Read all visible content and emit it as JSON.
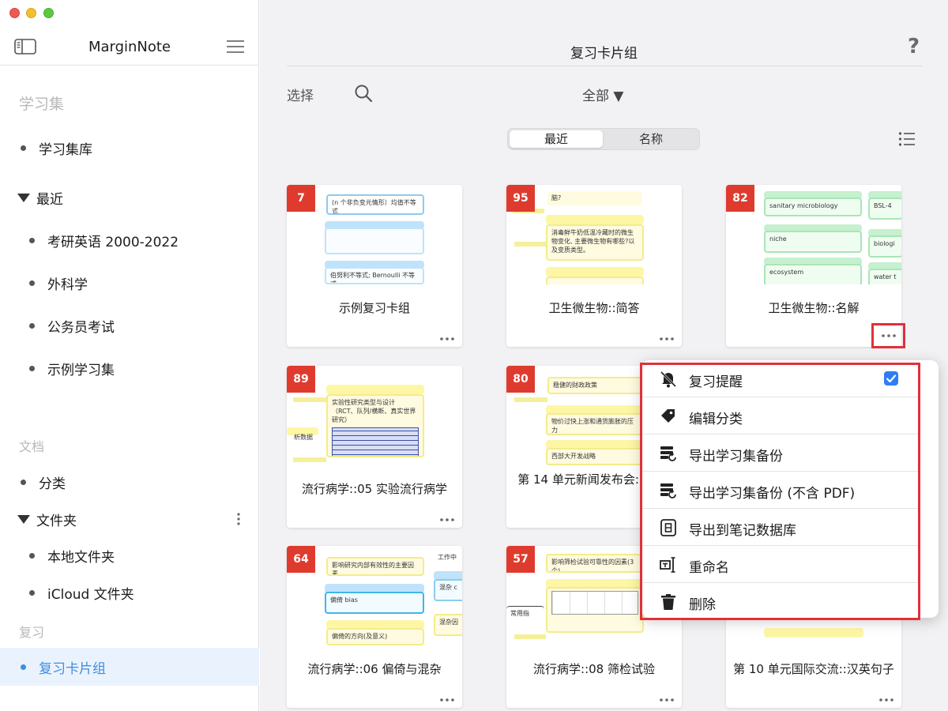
{
  "sidebar": {
    "app_title": "MarginNote",
    "section_study": "学习集",
    "library": "学习集库",
    "recent": "最近",
    "recent_items": [
      "考研英语 2000-2022",
      "外科学",
      "公务员考试",
      "示例学习集"
    ],
    "section_docs": "文档",
    "categories": "分类",
    "folders": "文件夹",
    "folder_items": [
      "本地文件夹",
      "iCloud 文件夹"
    ],
    "section_review": "复习",
    "review_active": "复习卡片组"
  },
  "main": {
    "title": "复习卡片组",
    "help": "?",
    "select": "选择",
    "filter": "全部 ▼",
    "seg_recent": "最近",
    "seg_name": "名称"
  },
  "cards": [
    {
      "count": "7",
      "title": "示例复习卡组",
      "thumb": [
        "(n 个非负变元情形）均值不等式",
        "伯努利不等式; Bernoulli 不等式;"
      ]
    },
    {
      "count": "95",
      "title": "卫生微生物::简答",
      "thumb": [
        "脑?",
        "消毒鲜牛奶低温冷藏时的微生物变化, 主要微生物有哪些?以及变质类型。"
      ]
    },
    {
      "count": "82",
      "title": "卫生微生物::名解",
      "thumb": [
        "sanitary microbiology",
        "BSL-4",
        "niche",
        "biologi",
        "ecosystem",
        "water t"
      ]
    },
    {
      "count": "89",
      "title": "流行病学::05 实验流行病学",
      "thumb": [
        "实验性研究类型与设计（RCT、队列/横断、真实世界研究）",
        "析数据"
      ]
    },
    {
      "count": "80",
      "title": "第 14 单元新闻发布会:: 词语",
      "thumb": [
        "稳健的财政政策",
        "物价过快上涨和通货膨胀的压力",
        "西部大开发战略"
      ]
    },
    {
      "count": "64",
      "title": "流行病学::06 偏倚与混杂",
      "thumb": [
        "影响研究内部有效性的主要因素",
        "工作中",
        "偏倚 bias",
        "混杂 c",
        "偏倚的方向(及意义)",
        "混杂因"
      ]
    },
    {
      "count": "57",
      "title": "流行病学::08 筛检试验",
      "thumb": [
        "影响筛检试验可靠性的因素(3个)",
        "常用指"
      ]
    },
    {
      "title": "第 10 单元国际交流::汉英句子"
    }
  ],
  "menu": {
    "items": [
      "复习提醒",
      "编辑分类",
      "导出学习集备份",
      "导出学习集备份 (不含 PDF)",
      "导出到笔记数据库",
      "重命名",
      "删除"
    ],
    "review_reminder_checked": true
  },
  "colors": {
    "accent": "#3e8de0",
    "badge": "#de3b2e",
    "highlight": "#e0303a",
    "checkbox": "#2f7df6"
  },
  "icons": [
    "sidebar-toggle-icon",
    "hamburger-icon",
    "search-icon",
    "list-view-icon",
    "more-icon",
    "bell-slash-icon",
    "tag-icon",
    "export-backup-icon",
    "database-icon",
    "rename-icon",
    "trash-icon"
  ]
}
